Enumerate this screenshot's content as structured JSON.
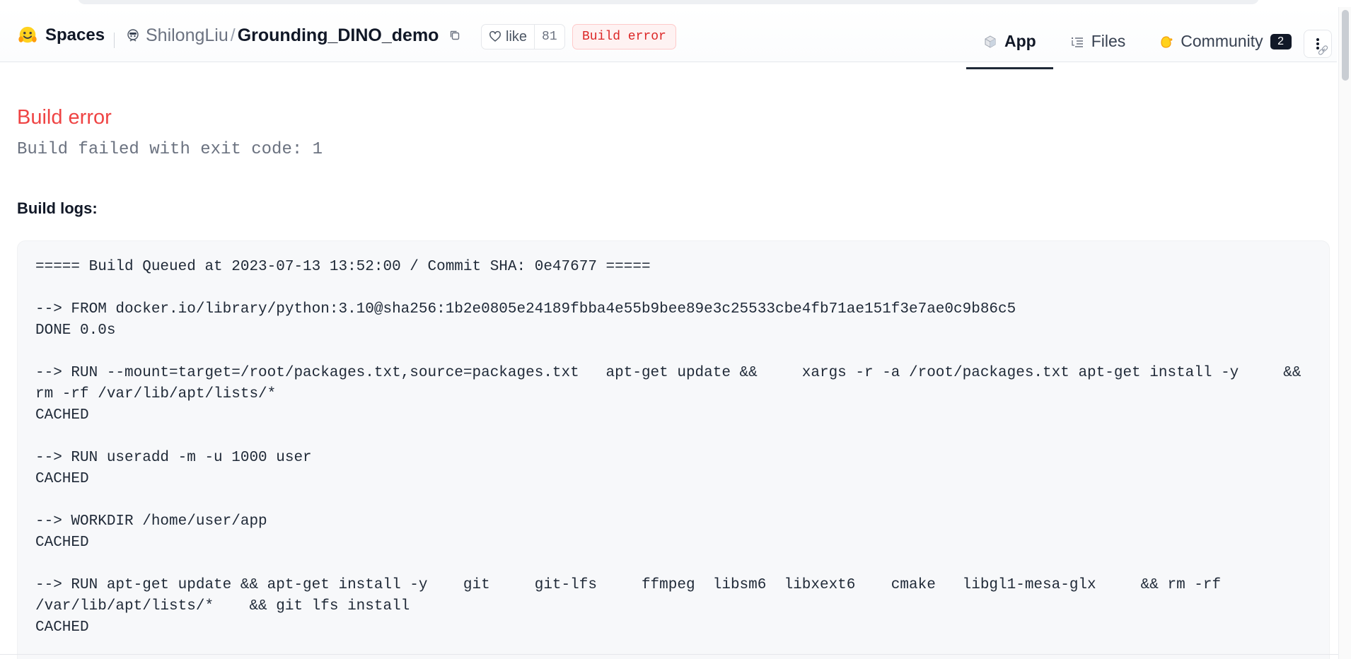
{
  "header": {
    "brand": "Spaces",
    "owner": "ShilongLiu",
    "separator": "/",
    "repo": "Grounding_DINO_demo",
    "like_label": "like",
    "like_count": "81",
    "status_badge": "Build error",
    "tabs": [
      {
        "label": "App",
        "icon": "cube-icon",
        "active": true
      },
      {
        "label": "Files",
        "icon": "files-icon",
        "active": false
      },
      {
        "label": "Community",
        "icon": "community-icon",
        "active": false,
        "count": "2"
      }
    ]
  },
  "main": {
    "error_title": "Build error",
    "error_detail": "Build failed with exit code: 1",
    "logs_label": "Build logs:",
    "logs": [
      "===== Build Queued at 2023-07-13 13:52:00 / Commit SHA: 0e47677 =====",
      "",
      "--> FROM docker.io/library/python:3.10@sha256:1b2e0805e24189fbba4e55b9bee89e3c25533cbe4fb71ae151f3e7ae0c9b86c5",
      "DONE 0.0s",
      "",
      "--> RUN --mount=target=/root/packages.txt,source=packages.txt   apt-get update &&     xargs -r -a /root/packages.txt apt-get install -y     &&",
      "rm -rf /var/lib/apt/lists/*",
      "CACHED",
      "",
      "--> RUN useradd -m -u 1000 user",
      "CACHED",
      "",
      "--> WORKDIR /home/user/app",
      "CACHED",
      "",
      "--> RUN apt-get update && apt-get install -y    git     git-lfs     ffmpeg  libsm6  libxext6    cmake   libgl1-mesa-glx     && rm -rf",
      "/var/lib/apt/lists/*    && git lfs install",
      "CACHED"
    ]
  },
  "colors": {
    "error": "#ef4444",
    "badge_text": "#dc2626",
    "badge_bg": "#fef2f2",
    "log_bg": "#f7f8fa"
  }
}
